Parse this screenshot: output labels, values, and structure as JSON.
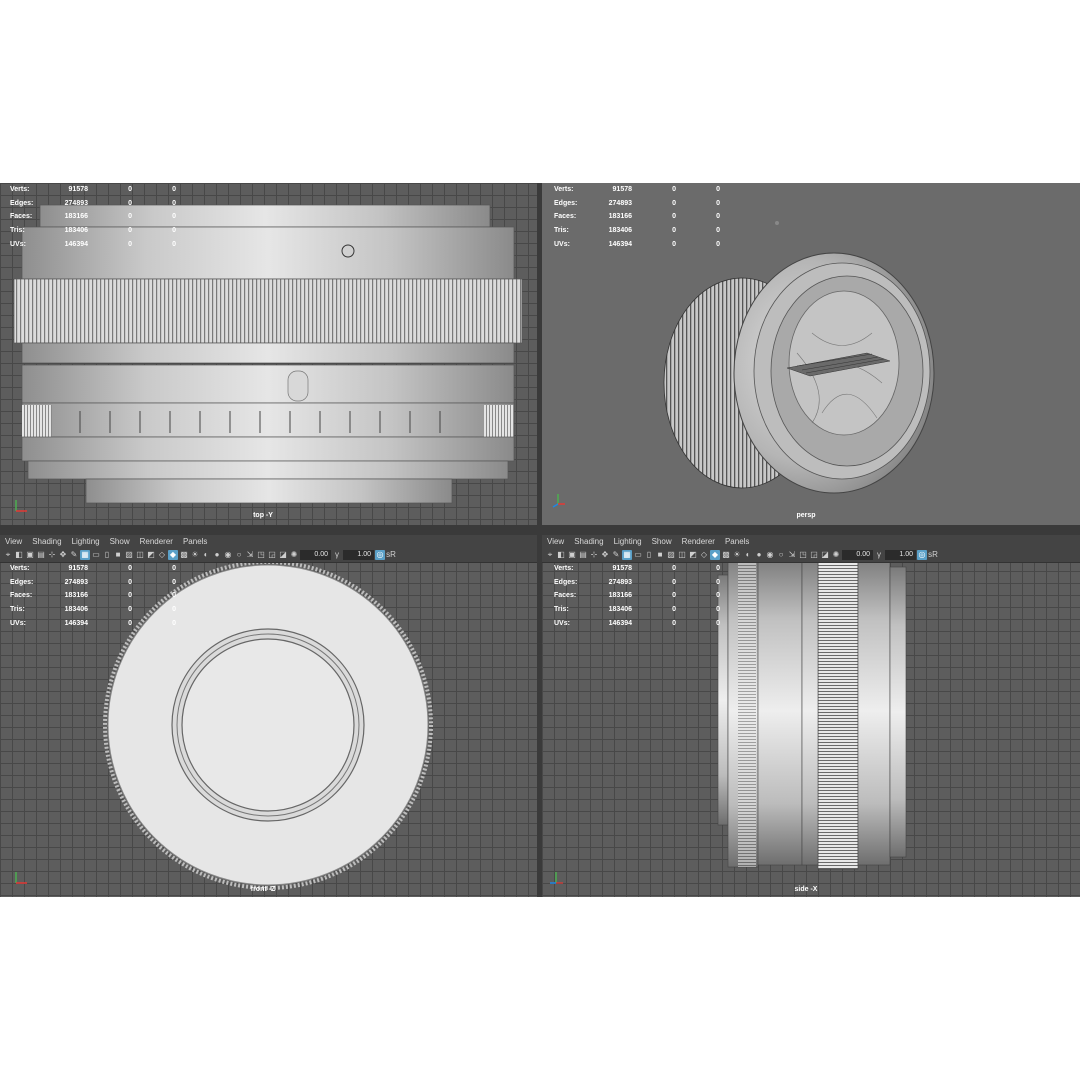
{
  "stats": {
    "labels": [
      "Verts:",
      "Edges:",
      "Faces:",
      "Tris:",
      "UVs:"
    ],
    "values": [
      "91578",
      "274893",
      "183166",
      "183406",
      "146394"
    ],
    "col2": [
      "0",
      "0",
      "0",
      "0",
      "0"
    ],
    "col3": [
      "0",
      "0",
      "0",
      "0",
      "0"
    ]
  },
  "panels": {
    "top_left": {
      "camera": "top -Y"
    },
    "top_right": {
      "camera": "persp"
    },
    "bottom_left": {
      "camera": "front -Z"
    },
    "bottom_right": {
      "camera": "side -X"
    }
  },
  "menu": [
    "View",
    "Shading",
    "Lighting",
    "Show",
    "Renderer",
    "Panels"
  ],
  "toolbar": {
    "field1": "0.00",
    "field2": "1.00",
    "srgb": "sR"
  },
  "colors": {
    "grid_bg": "#5d5d5d",
    "persp_bg": "#6b6b6b",
    "active_icon": "#5aa0c8"
  },
  "icons": [
    "select-camera-icon",
    "camera-attr-icon",
    "bookmark-icon",
    "image-plane-icon",
    "grid-icon",
    "film-gate-icon",
    "resolution-gate-icon",
    "wireframe-icon",
    "smooth-shade-icon",
    "textured-icon",
    "lights-icon",
    "shadows-icon",
    "ao-icon",
    "isolate-icon",
    "xray-icon",
    "exposure-icon",
    "gamma-icon",
    "color-management-icon"
  ]
}
